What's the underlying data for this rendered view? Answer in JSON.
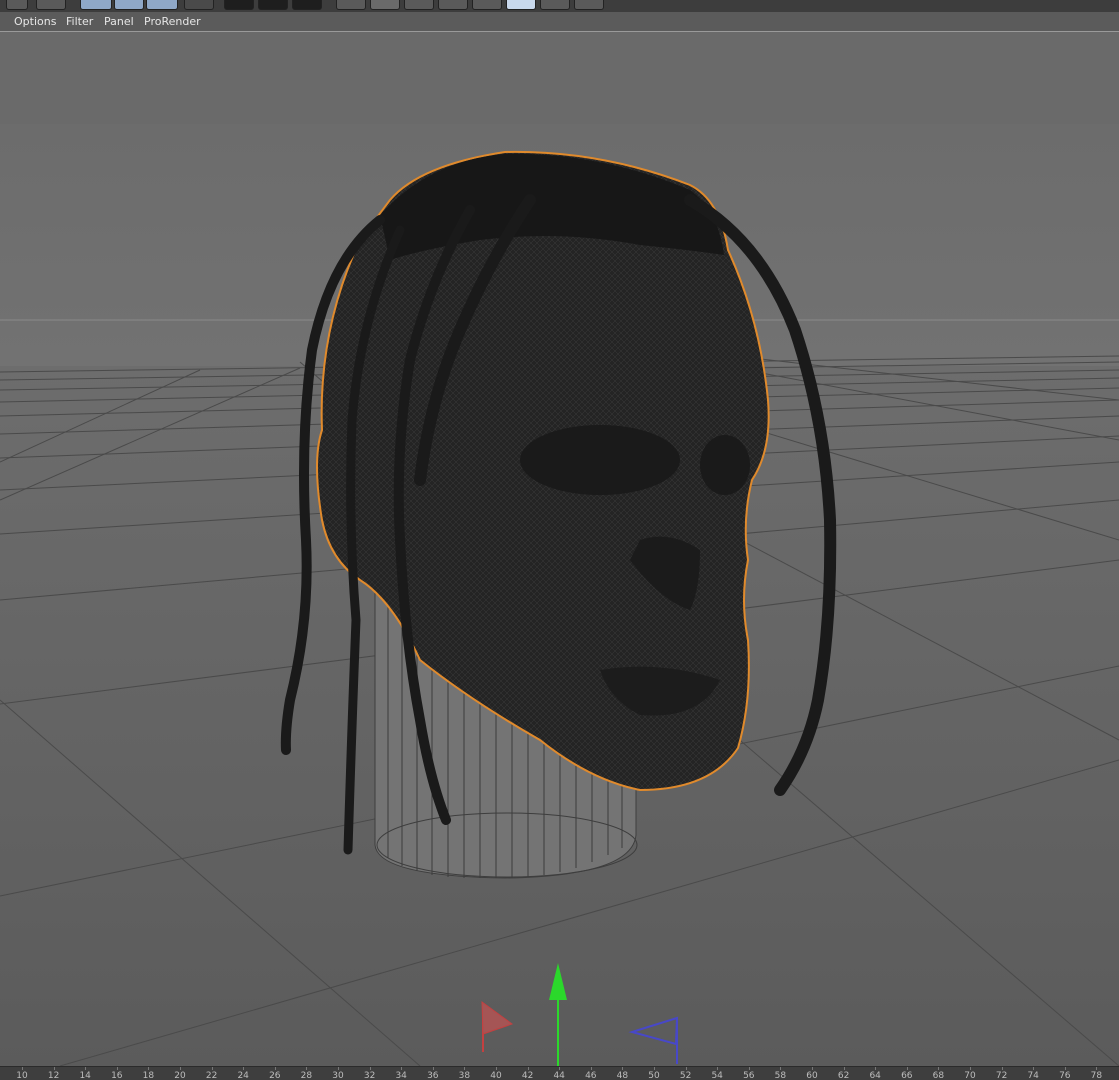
{
  "menu": {
    "items": [
      "Options",
      "Filter",
      "Panel",
      "ProRender"
    ]
  },
  "toolbar": {
    "icons": [
      "scale-tool-icon",
      "rotate-tool-icon",
      "object-mode-icon",
      "model-mode-icon",
      "axis-mode-icon",
      "arrow-icon",
      "render-region-icon",
      "render-view-icon",
      "render-settings-icon",
      "cube-icon",
      "subdivision-icon",
      "deformer-icon",
      "scene-icon",
      "environment-icon",
      "camera-icon",
      "light-icon"
    ]
  },
  "viewport": {
    "background": "#6b6b6b",
    "selection_color": "#e08a2c",
    "mesh_color": "#1c1c1c",
    "axis_colors": {
      "x": "#c44040",
      "y": "#2bd82b",
      "z": "#4848c8"
    }
  },
  "timeline": {
    "ticks": [
      "10",
      "12",
      "14",
      "16",
      "18",
      "20",
      "22",
      "24",
      "26",
      "28",
      "30",
      "32",
      "34",
      "36",
      "38",
      "40",
      "42",
      "44",
      "46",
      "48",
      "50",
      "52",
      "54",
      "56",
      "58",
      "60",
      "62",
      "64",
      "66",
      "68",
      "70",
      "72",
      "74",
      "76",
      "78"
    ]
  }
}
